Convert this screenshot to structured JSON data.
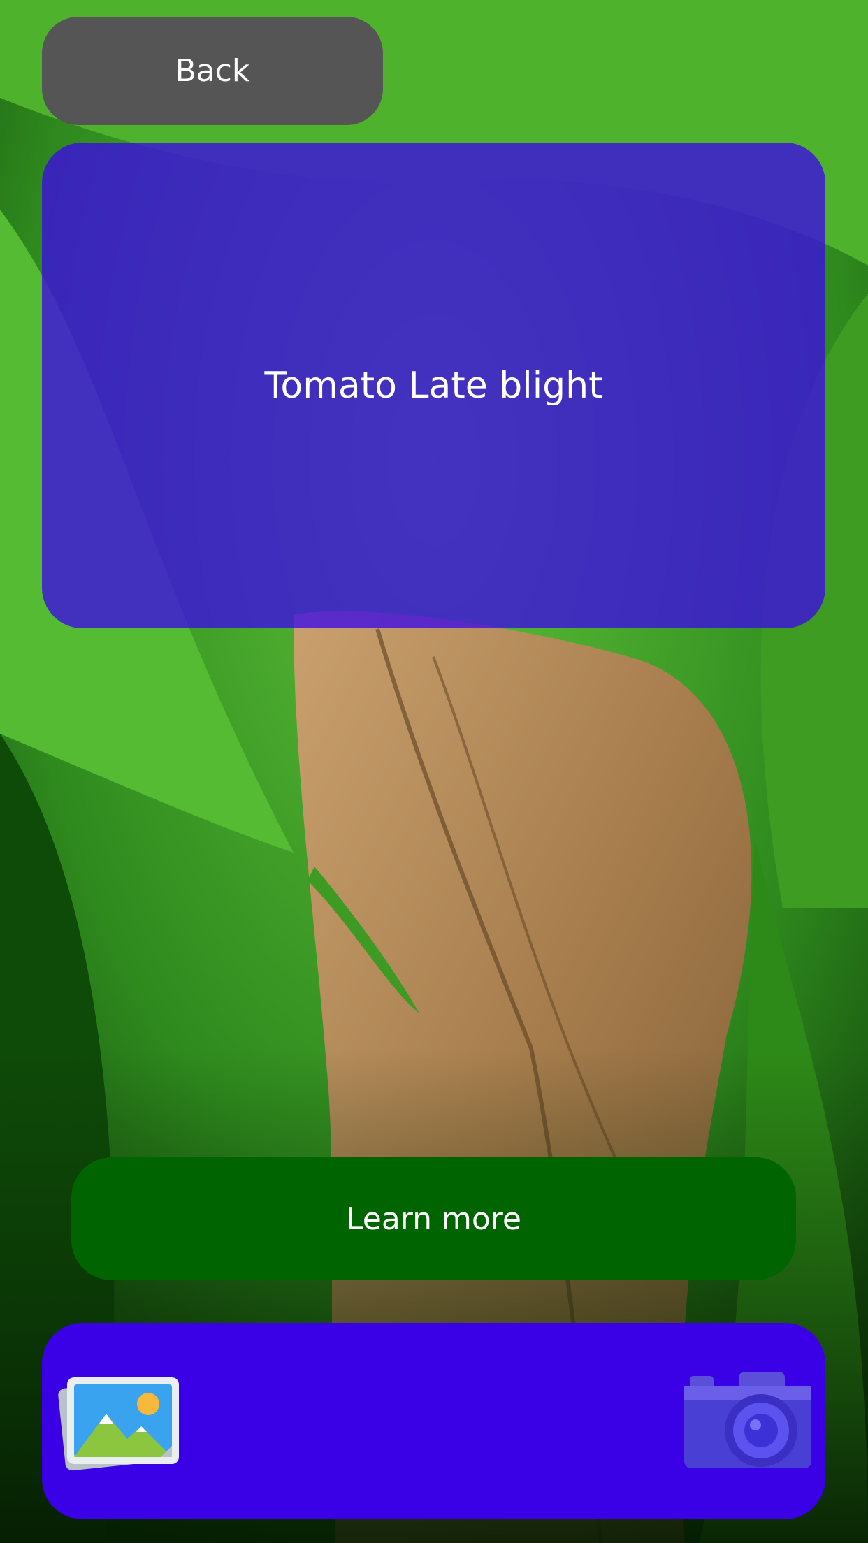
{
  "header": {
    "back_label": "Back"
  },
  "result": {
    "prediction": "Tomato Late blight"
  },
  "actions": {
    "learn_more_label": "Learn more"
  },
  "toolbar": {
    "gallery_icon": "photo-gallery-icon",
    "camera_icon": "camera-icon"
  },
  "colors": {
    "back_button": "#555555",
    "result_card": "#3c0ae6",
    "learn_more_button": "#006400",
    "bottom_bar": "#3a00e6"
  }
}
